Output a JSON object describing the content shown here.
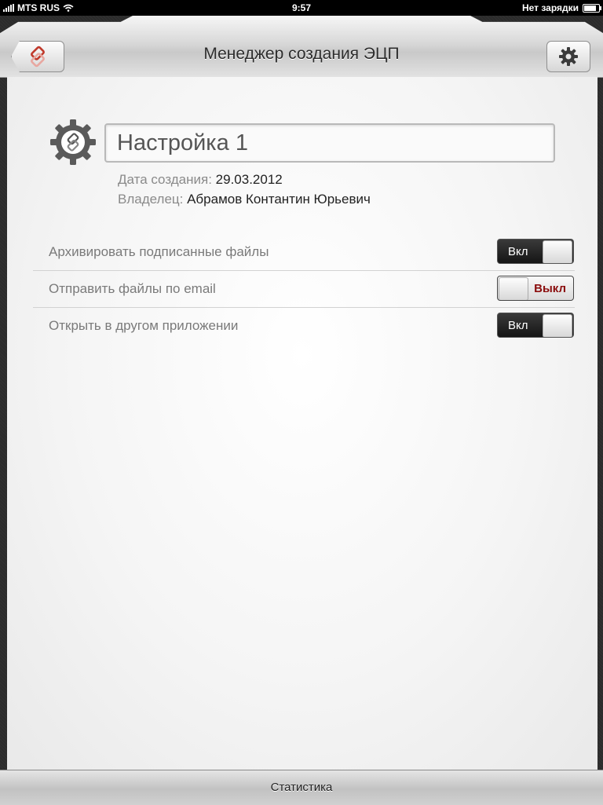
{
  "status_bar": {
    "carrier": "MTS RUS",
    "time": "9:57",
    "battery_text": "Нет зарядки"
  },
  "header": {
    "title": "Менеджер создания ЭЦП",
    "back_icon": "app-logo-icon",
    "settings_icon": "gear-icon"
  },
  "profile": {
    "name_value": "Настройка 1",
    "created_label": "Дата создания:",
    "created_value": "29.03.2012",
    "owner_label": "Владелец:",
    "owner_value": "Абрамов Контантин Юрьевич"
  },
  "options": [
    {
      "label": "Архивировать подписанные файлы",
      "state": "Вкл",
      "on": true
    },
    {
      "label": "Отправить файлы по email",
      "state": "Выкл",
      "on": false
    },
    {
      "label": "Открыть в другом приложении",
      "state": "Вкл",
      "on": true
    }
  ],
  "tabbar": {
    "stats_label": "Статистика"
  },
  "colors": {
    "accent_logo": "#c0392b",
    "off_text": "#8b0d0d"
  }
}
